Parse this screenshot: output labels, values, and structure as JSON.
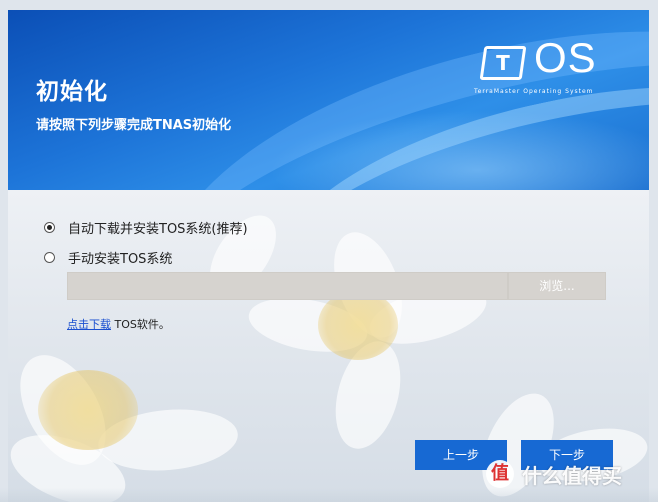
{
  "header": {
    "title": "初始化",
    "subtitle": "请按照下列步骤完成TNAS初始化",
    "logo": {
      "mark_letter": "T",
      "wordmark": "OS",
      "tagline": "TerraMaster Operating System"
    }
  },
  "options": {
    "auto_label": "自动下载并安装TOS系统(推荐)",
    "manual_label": "手动安装TOS系统",
    "selected": "auto"
  },
  "file_picker": {
    "value": "",
    "browse_label": "浏览..."
  },
  "download": {
    "link_text": "点击下载",
    "suffix_text": " TOS软件。"
  },
  "footer": {
    "prev_label": "上一步",
    "next_label": "下一步"
  },
  "watermark": {
    "logo_glyph": "值",
    "text": "什么值得买"
  },
  "colors": {
    "header_blue": "#1d74d8",
    "button_blue": "#1769d3",
    "link_blue": "#1a4fd0"
  }
}
